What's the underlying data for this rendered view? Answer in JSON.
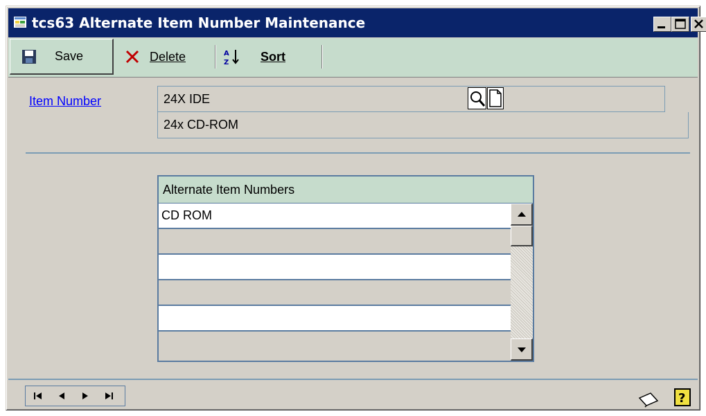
{
  "window": {
    "title": "tcs63 Alternate Item Number Maintenance",
    "controls": [
      "minimize-icon",
      "maximize-icon",
      "close-icon"
    ]
  },
  "toolbar": {
    "save_label": "Save",
    "delete_label": "Delete",
    "sort_label": "Sort"
  },
  "form": {
    "item_number_label": "Item Number",
    "item_number_value": "24X IDE",
    "description_value": "24x CD-ROM"
  },
  "grid": {
    "header": "Alternate Item Numbers",
    "rows": [
      "CD ROM",
      "",
      "",
      "",
      "",
      ""
    ]
  },
  "footer": {
    "nav_buttons": [
      "first-record-icon",
      "previous-record-icon",
      "next-record-icon",
      "last-record-icon"
    ],
    "right_icons": [
      "note-icon",
      "help-icon"
    ]
  },
  "colors": {
    "titlebar": "#0a246a",
    "toolbar": "#c6dccc",
    "window": "#d4d0c8",
    "link": "#0000ff",
    "border_blue": "#7b9cb4"
  }
}
